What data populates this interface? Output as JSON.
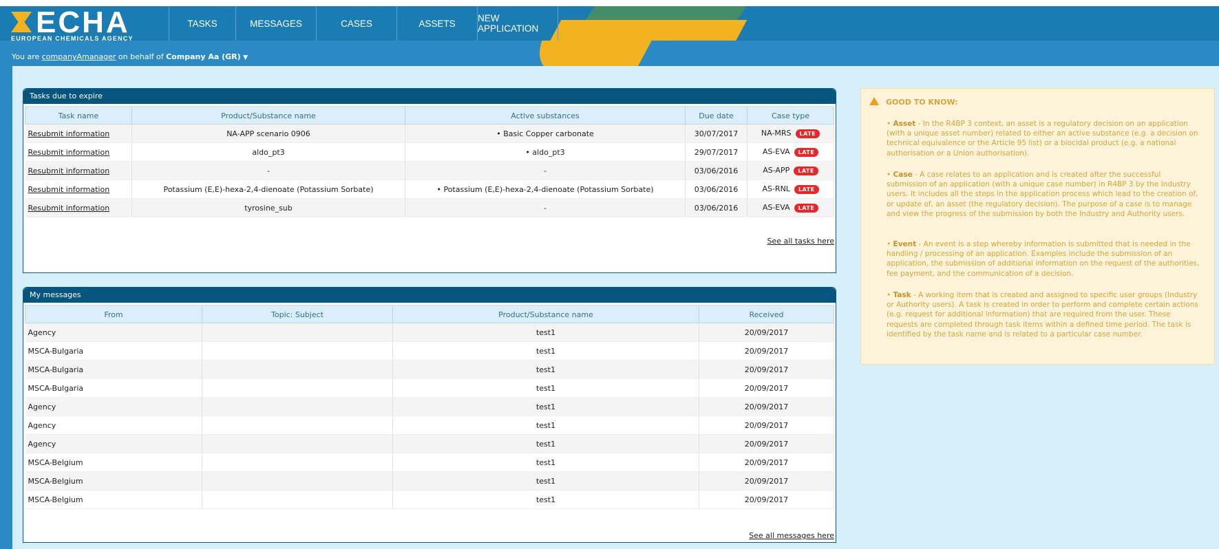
{
  "brand": {
    "logo_text": "ECHA",
    "logo_sub": "EUROPEAN CHEMICALS AGENCY"
  },
  "nav": [
    {
      "label": "TASKS"
    },
    {
      "label": "MESSAGES"
    },
    {
      "label": "CASES"
    },
    {
      "label": "ASSETS"
    },
    {
      "label": "NEW APPLICATION"
    }
  ],
  "user": {
    "prefix": "You are ",
    "username": "companyAmanager",
    "behalf": " on behalf of ",
    "company": "Company Aa (GR)"
  },
  "tasks_panel": {
    "title": "Tasks due to expire",
    "headers": [
      "Task name",
      "Product/Substance name",
      "Active substances",
      "Due date",
      "Case type"
    ],
    "rows": [
      {
        "task": "Resubmit information",
        "product": "NA-APP scenario 0906",
        "active": "• Basic Copper carbonate",
        "due": "30/07/2017",
        "case_type": "NA-MRS",
        "badge": "LATE"
      },
      {
        "task": "Resubmit information",
        "product": "aldo_pt3",
        "active": "• aldo_pt3",
        "due": "29/07/2017",
        "case_type": "AS-EVA",
        "badge": "LATE"
      },
      {
        "task": "Resubmit information",
        "product": "-",
        "active": "-",
        "due": "03/06/2016",
        "case_type": "AS-APP",
        "badge": "LATE"
      },
      {
        "task": "Resubmit information",
        "product": "Potassium (E,E)-hexa-2,4-dienoate (Potassium Sorbate)",
        "active": "• Potassium (E,E)-hexa-2,4-dienoate (Potassium Sorbate)",
        "due": "03/06/2016",
        "case_type": "AS-RNL",
        "badge": "LATE"
      },
      {
        "task": "Resubmit information",
        "product": "tyrosine_sub",
        "active": "-",
        "due": "03/06/2016",
        "case_type": "AS-EVA",
        "badge": "LATE"
      }
    ],
    "see_all": "See all tasks here"
  },
  "messages_panel": {
    "title": "My messages",
    "headers": [
      "From",
      "Topic: Subject",
      "Product/Substance name",
      "Received"
    ],
    "rows": [
      {
        "from": "Agency",
        "subject": "",
        "product": "test1",
        "received": "20/09/2017"
      },
      {
        "from": "MSCA-Bulgaria",
        "subject": "",
        "product": "test1",
        "received": "20/09/2017"
      },
      {
        "from": "MSCA-Bulgaria",
        "subject": "",
        "product": "test1",
        "received": "20/09/2017"
      },
      {
        "from": "MSCA-Bulgaria",
        "subject": "",
        "product": "test1",
        "received": "20/09/2017"
      },
      {
        "from": "Agency",
        "subject": "",
        "product": "test1",
        "received": "20/09/2017"
      },
      {
        "from": "Agency",
        "subject": "",
        "product": "test1",
        "received": "20/09/2017"
      },
      {
        "from": "Agency",
        "subject": "",
        "product": "test1",
        "received": "20/09/2017"
      },
      {
        "from": "MSCA-Belgium",
        "subject": "",
        "product": "test1",
        "received": "20/09/2017"
      },
      {
        "from": "MSCA-Belgium",
        "subject": "",
        "product": "test1",
        "received": "20/09/2017"
      },
      {
        "from": "MSCA-Belgium",
        "subject": "",
        "product": "test1",
        "received": "20/09/2017"
      }
    ],
    "see_all": "See all messages here"
  },
  "good_to_know": {
    "title": "GOOD TO KNOW:",
    "items": [
      {
        "term": "Asset",
        "text": " - In the R4BP 3 context, an asset is a regulatory decision on an application (with a unique asset number) related to either an active substance (e.g. a decision on technical equivalence or the Article 95 list) or a biocidal product (e.g. a national authorisation or a Union authorisation)."
      },
      {
        "term": "Case",
        "text": " - A case relates to an application and is created after the successful submission of an application (with a unique case number) in R4BP 3 by the Industry users. It includes all the steps in the application process which lead to the creation of, or update of, an asset (the regulatory decision). The purpose of a case is to manage and view the progress of the submission by both the Industry and Authority users."
      },
      {
        "term": "Event",
        "text": " - An event is a step whereby information is submitted that is needed in the handling / processing of an application. Examples include the submission of an application, the submission of additional information on the request of the authorities, fee payment, and the communication of a decision."
      },
      {
        "term": "Task",
        "text": " - A working item that is created and assigned to specific user groups (Industry or Authority users). A task is created in order to perform and complete certain actions (e.g. request for additional information) that are required from the user. These requests are completed through task items within a defined time period. The task is identified by the task name and is related to a particular case number."
      }
    ]
  },
  "colors": {
    "header_blue": "#1b7cb4",
    "panel_title": "#06557f",
    "late_red": "#e8272a",
    "message_red": "#e2141b",
    "content_bg": "#d7eefb",
    "gtk_bg": "#fdf3d8",
    "gtk_text": "#d7a43b"
  }
}
